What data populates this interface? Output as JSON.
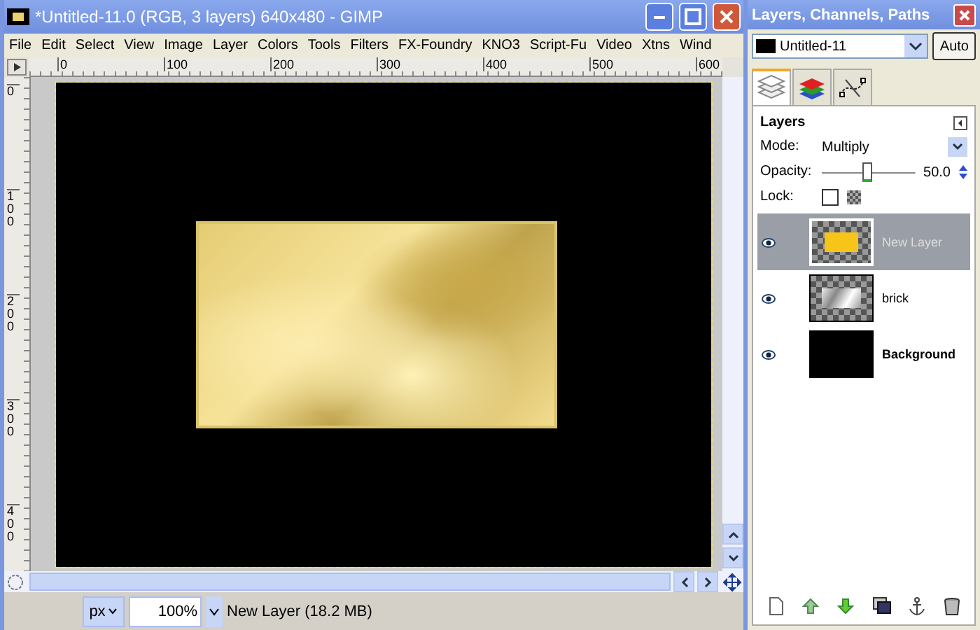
{
  "window": {
    "title": "*Untitled-11.0 (RGB, 3 layers) 640x480 - GIMP"
  },
  "menu": [
    "File",
    "Edit",
    "Select",
    "View",
    "Image",
    "Layer",
    "Colors",
    "Tools",
    "Filters",
    "FX-Foundry",
    "KNO3",
    "Script-Fu",
    "Video",
    "Xtns",
    "Wind"
  ],
  "rulers": {
    "horizontal": [
      "0",
      "100",
      "200",
      "300",
      "400",
      "500",
      "600"
    ],
    "vertical": [
      "0",
      "100",
      "200",
      "300",
      "400"
    ]
  },
  "status_bar": {
    "unit": "px",
    "zoom": "100%",
    "message": "New Layer (18.2 MB)"
  },
  "dock": {
    "title": "Layers, Channels, Paths",
    "image": "Untitled-11",
    "auto_button": "Auto",
    "tabs": [
      {
        "kind": "layers",
        "selected": true
      },
      {
        "kind": "channels",
        "selected": false
      },
      {
        "kind": "paths",
        "selected": false
      }
    ],
    "section_title": "Layers",
    "mode_label": "Mode:",
    "mode": "Multiply",
    "opacity_label": "Opacity:",
    "opacity": {
      "level": 0.5,
      "reading": "50.0"
    },
    "lock_label": "Lock:",
    "lock": {
      "checked": false
    },
    "layers": [
      {
        "name": "New Layer",
        "kind": "fill",
        "selected": true,
        "visible": true
      },
      {
        "name": "brick",
        "kind": "texture",
        "selected": false,
        "visible": true
      },
      {
        "name": "Background",
        "kind": "solid",
        "selected": false,
        "visible": true
      }
    ]
  }
}
